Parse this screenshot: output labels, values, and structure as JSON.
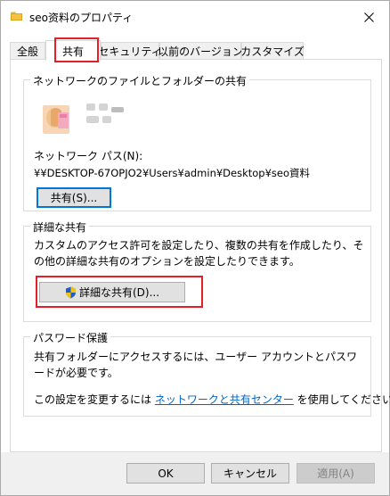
{
  "window": {
    "title": "seo资料のプロパティ",
    "close_icon": "close-icon"
  },
  "tabs": [
    {
      "label": "全般"
    },
    {
      "label": "共有",
      "active": true
    },
    {
      "label": "セキュリティ"
    },
    {
      "label": "以前のバージョン"
    },
    {
      "label": "カスタマイズ"
    }
  ],
  "network_sharing": {
    "legend": "ネットワークのファイルとフォルダーの共有",
    "path_label": "ネットワーク パス(N):",
    "path_value": "¥¥DESKTOP-67OPJO2¥Users¥admin¥Desktop¥seo資料",
    "share_button": "共有(S)..."
  },
  "advanced_sharing": {
    "legend": "詳細な共有",
    "description": "カスタムのアクセス許可を設定したり、複数の共有を作成したり、その他の詳細な共有のオプションを設定したりできます。",
    "button": "詳細な共有(D)...",
    "button_icon": "shield-icon"
  },
  "password_protection": {
    "legend": "パスワード保護",
    "description": "共有フォルダーにアクセスするには、ユーザー アカウントとパスワードが必要です。",
    "change_prefix": "この設定を変更するには ",
    "change_link": "ネットワークと共有センター",
    "change_suffix": " を使用してください。"
  },
  "footer": {
    "ok": "OK",
    "cancel": "キャンセル",
    "apply": "適用(A)"
  },
  "colors": {
    "highlight": "#e51f28",
    "link": "#0066cc",
    "focus": "#0078d7"
  }
}
